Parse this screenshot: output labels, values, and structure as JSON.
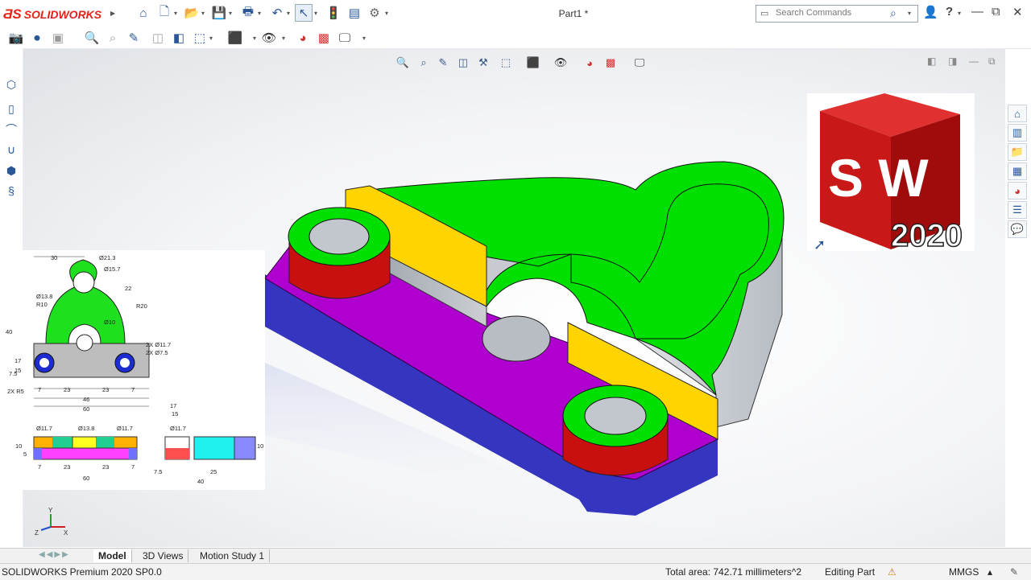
{
  "app": {
    "brand": "SOLIDWORKS",
    "document_title": "Part1 *"
  },
  "search": {
    "placeholder": "Search Commands"
  },
  "window_controls": {
    "help": "?",
    "minimize": "—",
    "restore": "⧉",
    "close": "✕"
  },
  "tabs": [
    {
      "label": "Model",
      "active": true
    },
    {
      "label": "3D Views",
      "active": false
    },
    {
      "label": "Motion Study 1",
      "active": false
    }
  ],
  "status": {
    "product": "SOLIDWORKS Premium 2020 SP0.0",
    "total_area": "Total area: 742.71 millimeters^2",
    "mode": "Editing Part",
    "units": "MMGS"
  },
  "drawing": {
    "dims": [
      "30",
      "Ø21.3",
      "Ø15.7",
      "22",
      "R20",
      "Ø13.8",
      "R10",
      "Ø10",
      "2X Ø11.7",
      "2X Ø7.5",
      "40",
      "17",
      "15",
      "7.5",
      "2X R5",
      "7",
      "23",
      "23",
      "7",
      "46",
      "60",
      "Ø11.7",
      "Ø13.8",
      "Ø11.7",
      "10",
      "5",
      "7",
      "23",
      "23",
      "7",
      "60",
      "17",
      "15",
      "Ø11.7",
      "10",
      "7.5",
      "25",
      "40"
    ]
  },
  "sw_logo": {
    "letters": "SW",
    "year": "2020"
  },
  "colors": {
    "green": "#00e000",
    "yellow": "#ffd400",
    "magenta": "#b000d0",
    "blue": "#3535c0",
    "red": "#c81010",
    "gray": "#c8cdd2"
  },
  "triad": {
    "x": "X",
    "y": "Y",
    "z": "Z"
  }
}
